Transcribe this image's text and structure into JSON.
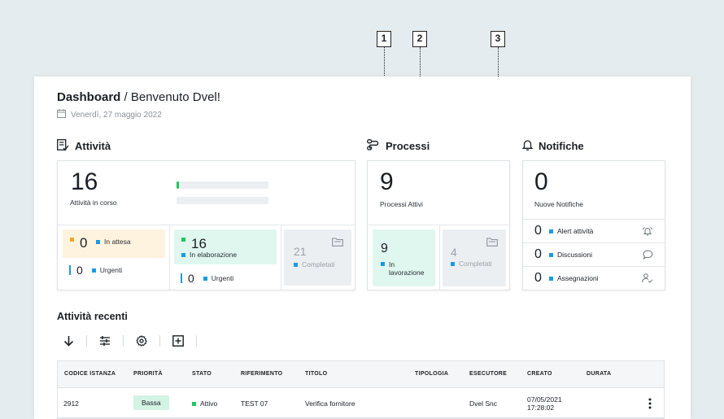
{
  "callouts": [
    "1",
    "2",
    "3"
  ],
  "header": {
    "title_bold": "Dashboard",
    "title_rest": " / Benvenuto Dvel!",
    "date": "Venerdì, 27 maggio 2022"
  },
  "attivita": {
    "heading": "Attività",
    "count": "16",
    "count_label": "Attività in corso",
    "progress_fraction": 0.03,
    "in_attesa": {
      "count": "0",
      "label": "In attesa",
      "urgent_count": "0",
      "urgent_label": "Urgenti"
    },
    "in_elaborazione": {
      "count": "16",
      "label": "In elaborazione",
      "urgent_count": "0",
      "urgent_label": "Urgenti"
    },
    "completati": {
      "count": "21",
      "label": "Completati"
    }
  },
  "processi": {
    "heading": "Processi",
    "count": "9",
    "count_label": "Processi Attivi",
    "in_lavorazione": {
      "count": "9",
      "label": "In lavorazione"
    },
    "completati": {
      "count": "4",
      "label": "Completati"
    }
  },
  "notifiche": {
    "heading": "Notifiche",
    "count": "0",
    "count_label": "Nuove Notifiche",
    "rows": [
      {
        "count": "0",
        "label": "Alert attività",
        "icon": "bell-alert-icon"
      },
      {
        "count": "0",
        "label": "Discussioni",
        "icon": "chat-bubble-icon"
      },
      {
        "count": "0",
        "label": "Assegnazioni",
        "icon": "user-check-icon"
      }
    ]
  },
  "recenti": {
    "heading": "Attività recenti",
    "toolbar_icons": [
      "arrow-down-icon",
      "sliders-icon",
      "gear-icon",
      "plus-box-icon"
    ],
    "columns": [
      "CODICE ISTANZA",
      "PRIORITÀ",
      "STATO",
      "RIFERIMENTO",
      "TITOLO",
      "TIPOLOGIA",
      "ESECUTORE",
      "CREATO",
      "DURATA"
    ],
    "rows": [
      {
        "codice": "2912",
        "priorita": "Bassa",
        "stato": "Attivo",
        "riferimento": "TEST 07",
        "titolo": "Verifica fornitore",
        "tipologia": "",
        "esecutore": "Dvel Snc",
        "creato_date": "07/05/2021",
        "creato_time": "17:28:02",
        "durata": ""
      }
    ]
  },
  "colors": {
    "accent_blue": "#1a9be0",
    "green": "#22c55e",
    "orange": "#f5a623",
    "tile_yellow": "#fdf3df",
    "tile_mint": "#dff7ef",
    "tile_grey": "#eceff1",
    "badge_green": "#d3f3e4"
  }
}
